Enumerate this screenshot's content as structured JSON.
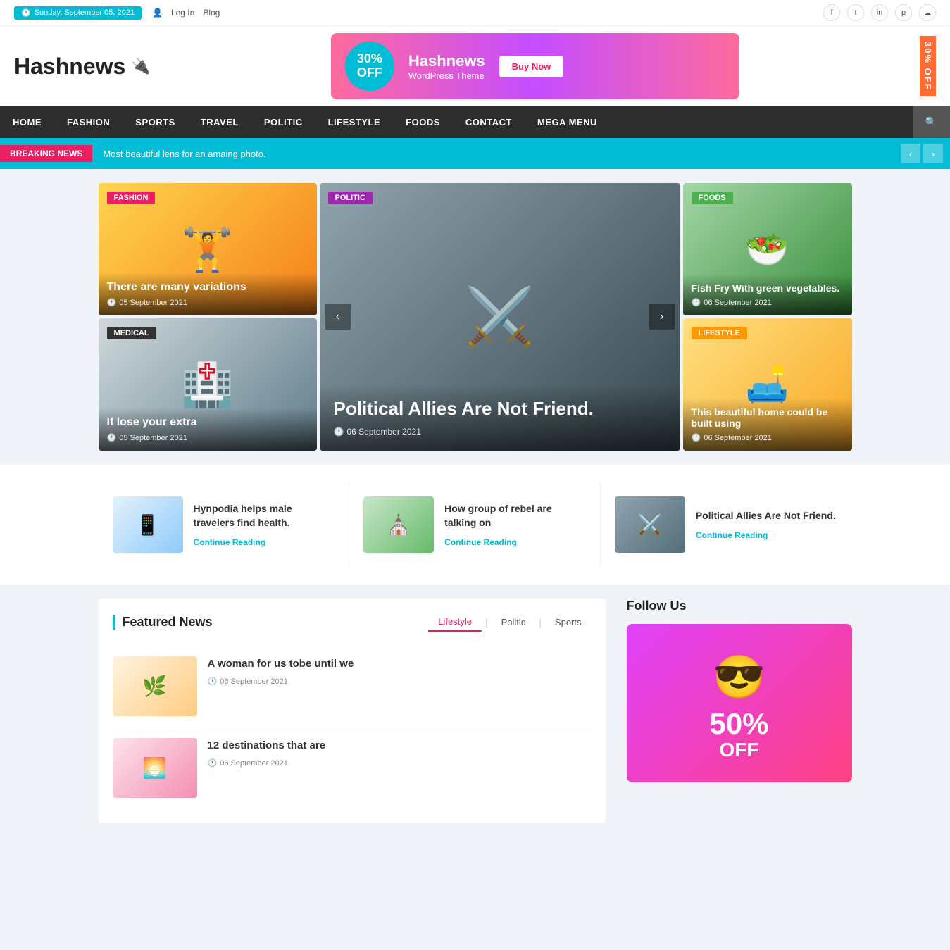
{
  "topbar": {
    "date": "Sunday, September 05, 2021",
    "login": "Log In",
    "blog": "Blog"
  },
  "social": [
    "f",
    "t",
    "in",
    "p",
    "rss"
  ],
  "logo": {
    "text": "Hashnews",
    "icon": "🔌"
  },
  "banner": {
    "percent": "30%",
    "off": "OFF",
    "brand": "Hashnews",
    "subtitle": "WordPress Theme",
    "buy_label": "Buy Now",
    "side": "30% OFF"
  },
  "nav": {
    "items": [
      "HOME",
      "FASHION",
      "SPORTS",
      "TRAVEL",
      "POLITIC",
      "LIFESTYLE",
      "FOODS",
      "CONTACT",
      "MEGA MENU"
    ]
  },
  "breaking": {
    "label": "BREAKING NEWS",
    "text": "Most beautiful lens for an amaing photo."
  },
  "hero_left": {
    "card1": {
      "badge": "FASHION",
      "badge_class": "badge-fashion",
      "title": "There are many variations",
      "date": "05 September 2021"
    },
    "card2": {
      "badge": "MEDICAL",
      "badge_class": "badge-medical",
      "title": "If lose your extra",
      "date": "05 September 2021"
    }
  },
  "hero_center": {
    "badge": "POLITIC",
    "title": "Political Allies Are Not Friend.",
    "date": "06 September 2021"
  },
  "hero_right": {
    "card1": {
      "badge": "FOODS",
      "badge_class": "badge-foods",
      "title": "Fish Fry With green vegetables.",
      "date": "06 September 2021"
    },
    "card2": {
      "badge": "LIFESTYLE",
      "badge_class": "badge-lifestyle",
      "title": "This beautiful home could be built using",
      "date": "06 September 2021"
    }
  },
  "featured_cards": [
    {
      "title": "Hynpodia helps male travelers find health.",
      "link": "Continue Reading"
    },
    {
      "title": "How group of rebel are talking on",
      "link": "Continue Reading"
    },
    {
      "title": "Political Allies Are Not Friend.",
      "link": "Continue Reading"
    }
  ],
  "bottom": {
    "section_title": "Featured News",
    "tabs": [
      "Lifestyle",
      "Politic",
      "Sports"
    ],
    "active_tab": "Lifestyle",
    "news_items": [
      {
        "title": "A woman for us tobe until we",
        "date": "06 September 2021"
      },
      {
        "title": "12 destinations that are",
        "date": "06 September 2021"
      }
    ],
    "follow_title": "Follow Us",
    "follow_banner_percent": "50%",
    "follow_banner_off": "OFF"
  }
}
